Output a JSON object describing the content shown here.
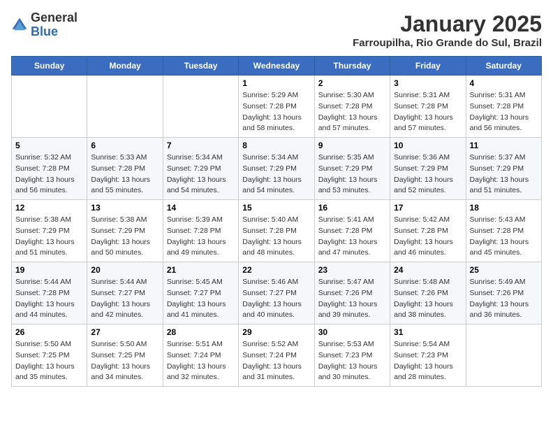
{
  "header": {
    "logo_general": "General",
    "logo_blue": "Blue",
    "month_title": "January 2025",
    "location": "Farroupilha, Rio Grande do Sul, Brazil"
  },
  "days_of_week": [
    "Sunday",
    "Monday",
    "Tuesday",
    "Wednesday",
    "Thursday",
    "Friday",
    "Saturday"
  ],
  "weeks": [
    [
      {
        "day": "",
        "sunrise": "",
        "sunset": "",
        "daylight": ""
      },
      {
        "day": "",
        "sunrise": "",
        "sunset": "",
        "daylight": ""
      },
      {
        "day": "",
        "sunrise": "",
        "sunset": "",
        "daylight": ""
      },
      {
        "day": "1",
        "sunrise": "Sunrise: 5:29 AM",
        "sunset": "Sunset: 7:28 PM",
        "daylight": "Daylight: 13 hours and 58 minutes."
      },
      {
        "day": "2",
        "sunrise": "Sunrise: 5:30 AM",
        "sunset": "Sunset: 7:28 PM",
        "daylight": "Daylight: 13 hours and 57 minutes."
      },
      {
        "day": "3",
        "sunrise": "Sunrise: 5:31 AM",
        "sunset": "Sunset: 7:28 PM",
        "daylight": "Daylight: 13 hours and 57 minutes."
      },
      {
        "day": "4",
        "sunrise": "Sunrise: 5:31 AM",
        "sunset": "Sunset: 7:28 PM",
        "daylight": "Daylight: 13 hours and 56 minutes."
      }
    ],
    [
      {
        "day": "5",
        "sunrise": "Sunrise: 5:32 AM",
        "sunset": "Sunset: 7:28 PM",
        "daylight": "Daylight: 13 hours and 56 minutes."
      },
      {
        "day": "6",
        "sunrise": "Sunrise: 5:33 AM",
        "sunset": "Sunset: 7:28 PM",
        "daylight": "Daylight: 13 hours and 55 minutes."
      },
      {
        "day": "7",
        "sunrise": "Sunrise: 5:34 AM",
        "sunset": "Sunset: 7:29 PM",
        "daylight": "Daylight: 13 hours and 54 minutes."
      },
      {
        "day": "8",
        "sunrise": "Sunrise: 5:34 AM",
        "sunset": "Sunset: 7:29 PM",
        "daylight": "Daylight: 13 hours and 54 minutes."
      },
      {
        "day": "9",
        "sunrise": "Sunrise: 5:35 AM",
        "sunset": "Sunset: 7:29 PM",
        "daylight": "Daylight: 13 hours and 53 minutes."
      },
      {
        "day": "10",
        "sunrise": "Sunrise: 5:36 AM",
        "sunset": "Sunset: 7:29 PM",
        "daylight": "Daylight: 13 hours and 52 minutes."
      },
      {
        "day": "11",
        "sunrise": "Sunrise: 5:37 AM",
        "sunset": "Sunset: 7:29 PM",
        "daylight": "Daylight: 13 hours and 51 minutes."
      }
    ],
    [
      {
        "day": "12",
        "sunrise": "Sunrise: 5:38 AM",
        "sunset": "Sunset: 7:29 PM",
        "daylight": "Daylight: 13 hours and 51 minutes."
      },
      {
        "day": "13",
        "sunrise": "Sunrise: 5:38 AM",
        "sunset": "Sunset: 7:29 PM",
        "daylight": "Daylight: 13 hours and 50 minutes."
      },
      {
        "day": "14",
        "sunrise": "Sunrise: 5:39 AM",
        "sunset": "Sunset: 7:28 PM",
        "daylight": "Daylight: 13 hours and 49 minutes."
      },
      {
        "day": "15",
        "sunrise": "Sunrise: 5:40 AM",
        "sunset": "Sunset: 7:28 PM",
        "daylight": "Daylight: 13 hours and 48 minutes."
      },
      {
        "day": "16",
        "sunrise": "Sunrise: 5:41 AM",
        "sunset": "Sunset: 7:28 PM",
        "daylight": "Daylight: 13 hours and 47 minutes."
      },
      {
        "day": "17",
        "sunrise": "Sunrise: 5:42 AM",
        "sunset": "Sunset: 7:28 PM",
        "daylight": "Daylight: 13 hours and 46 minutes."
      },
      {
        "day": "18",
        "sunrise": "Sunrise: 5:43 AM",
        "sunset": "Sunset: 7:28 PM",
        "daylight": "Daylight: 13 hours and 45 minutes."
      }
    ],
    [
      {
        "day": "19",
        "sunrise": "Sunrise: 5:44 AM",
        "sunset": "Sunset: 7:28 PM",
        "daylight": "Daylight: 13 hours and 44 minutes."
      },
      {
        "day": "20",
        "sunrise": "Sunrise: 5:44 AM",
        "sunset": "Sunset: 7:27 PM",
        "daylight": "Daylight: 13 hours and 42 minutes."
      },
      {
        "day": "21",
        "sunrise": "Sunrise: 5:45 AM",
        "sunset": "Sunset: 7:27 PM",
        "daylight": "Daylight: 13 hours and 41 minutes."
      },
      {
        "day": "22",
        "sunrise": "Sunrise: 5:46 AM",
        "sunset": "Sunset: 7:27 PM",
        "daylight": "Daylight: 13 hours and 40 minutes."
      },
      {
        "day": "23",
        "sunrise": "Sunrise: 5:47 AM",
        "sunset": "Sunset: 7:26 PM",
        "daylight": "Daylight: 13 hours and 39 minutes."
      },
      {
        "day": "24",
        "sunrise": "Sunrise: 5:48 AM",
        "sunset": "Sunset: 7:26 PM",
        "daylight": "Daylight: 13 hours and 38 minutes."
      },
      {
        "day": "25",
        "sunrise": "Sunrise: 5:49 AM",
        "sunset": "Sunset: 7:26 PM",
        "daylight": "Daylight: 13 hours and 36 minutes."
      }
    ],
    [
      {
        "day": "26",
        "sunrise": "Sunrise: 5:50 AM",
        "sunset": "Sunset: 7:25 PM",
        "daylight": "Daylight: 13 hours and 35 minutes."
      },
      {
        "day": "27",
        "sunrise": "Sunrise: 5:50 AM",
        "sunset": "Sunset: 7:25 PM",
        "daylight": "Daylight: 13 hours and 34 minutes."
      },
      {
        "day": "28",
        "sunrise": "Sunrise: 5:51 AM",
        "sunset": "Sunset: 7:24 PM",
        "daylight": "Daylight: 13 hours and 32 minutes."
      },
      {
        "day": "29",
        "sunrise": "Sunrise: 5:52 AM",
        "sunset": "Sunset: 7:24 PM",
        "daylight": "Daylight: 13 hours and 31 minutes."
      },
      {
        "day": "30",
        "sunrise": "Sunrise: 5:53 AM",
        "sunset": "Sunset: 7:23 PM",
        "daylight": "Daylight: 13 hours and 30 minutes."
      },
      {
        "day": "31",
        "sunrise": "Sunrise: 5:54 AM",
        "sunset": "Sunset: 7:23 PM",
        "daylight": "Daylight: 13 hours and 28 minutes."
      },
      {
        "day": "",
        "sunrise": "",
        "sunset": "",
        "daylight": ""
      }
    ]
  ]
}
